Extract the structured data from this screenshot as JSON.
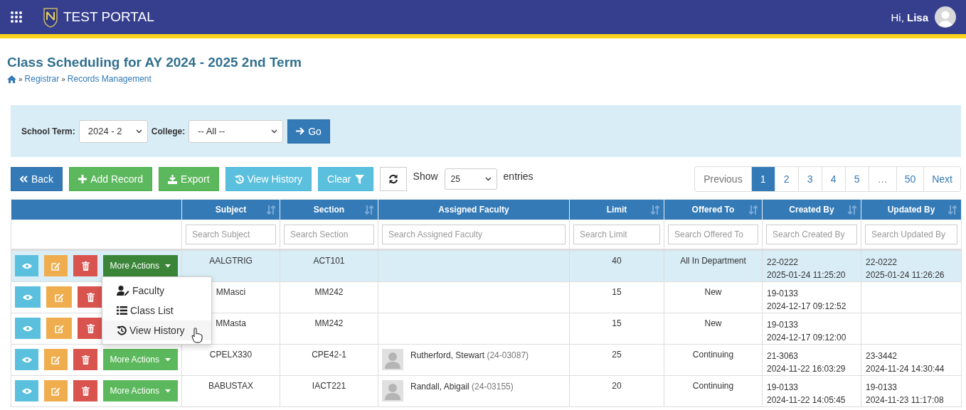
{
  "header": {
    "brand": "TEST PORTAL",
    "greeting": "Hi, ",
    "user": "Lisa"
  },
  "page": {
    "title": "Class Scheduling for AY 2024 - 2025 2nd Term",
    "breadcrumb": [
      "Registrar",
      "Records Management"
    ],
    "separator": "»"
  },
  "filter": {
    "term_label": "School Term:",
    "term_value": "2024 - 2",
    "college_label": "College:",
    "college_value": "-- All --",
    "go_button": "Go"
  },
  "toolbar": {
    "back": "Back",
    "add": "Add Record",
    "export": "Export",
    "history": "View History",
    "clear": "Clear",
    "show_label": "Show",
    "page_size": "25",
    "entries_label": "entries"
  },
  "pagination": [
    {
      "label": "Previous",
      "selected": false,
      "kind": "text"
    },
    {
      "label": "1",
      "selected": true,
      "kind": "link"
    },
    {
      "label": "2",
      "selected": false,
      "kind": "link"
    },
    {
      "label": "3",
      "selected": false,
      "kind": "link"
    },
    {
      "label": "4",
      "selected": false,
      "kind": "link"
    },
    {
      "label": "5",
      "selected": false,
      "kind": "link"
    },
    {
      "label": "…",
      "selected": false,
      "kind": "text"
    },
    {
      "label": "50",
      "selected": false,
      "kind": "link"
    },
    {
      "label": "Next",
      "selected": false,
      "kind": "link"
    }
  ],
  "table": {
    "columns": [
      {
        "label": "Subject",
        "placeholder": "Search Subject"
      },
      {
        "label": "Section",
        "placeholder": "Search Section"
      },
      {
        "label": "Assigned Faculty",
        "placeholder": "Search Assigned Faculty"
      },
      {
        "label": "Limit",
        "placeholder": "Search Limit"
      },
      {
        "label": "Offered To",
        "placeholder": "Search Offered To"
      },
      {
        "label": "Created By",
        "placeholder": "Search Created By"
      },
      {
        "label": "Updated By",
        "placeholder": "Search Updated By"
      }
    ],
    "rows": [
      {
        "selected": true,
        "more_actions": "More Actions",
        "subject": "AALGTRIG",
        "section": "ACT101",
        "limit": "40",
        "offered_to": "All In Department",
        "created_by": "22-0222",
        "created_at": "2025-01-24 11:25:20",
        "updated_by": "22-0222",
        "updated_at": "2025-01-24 11:26:26"
      },
      {
        "selected": false,
        "subject": "MMasci",
        "section": "MM242",
        "limit": "15",
        "offered_to": "New",
        "created_by": "19-0133",
        "created_at": "2024-12-17 09:12:52"
      },
      {
        "selected": false,
        "subject": "MMasta",
        "section": "MM242",
        "limit": "15",
        "offered_to": "New",
        "created_by": "19-0133",
        "created_at": "2024-12-17 09:12:00"
      },
      {
        "selected": false,
        "more_actions": "More Actions",
        "subject": "CPELX330",
        "section": "CPE42-1",
        "faculty_name": "Rutherford, Stewart",
        "faculty_id": "(24-03087)",
        "limit": "25",
        "offered_to": "Continuing",
        "created_by": "21-3063",
        "created_at": "2024-11-22 16:03:29",
        "updated_by": "23-3442",
        "updated_at": "2024-11-24 14:30:44"
      },
      {
        "selected": false,
        "more_actions": "More Actions",
        "subject": "BABUSTAX",
        "section": "IACT221",
        "faculty_name": "Randall, Abigail",
        "faculty_id": "(24-03155)",
        "limit": "20",
        "offered_to": "Continuing",
        "created_by": "19-0133",
        "created_at": "2024-11-22 14:05:45",
        "updated_by": "19-0133",
        "updated_at": "2024-11-23 11:17:08"
      }
    ]
  },
  "dropdown_menu": [
    {
      "label": "Faculty",
      "kind": "faculty",
      "selected": false
    },
    {
      "label": "Class List",
      "kind": "list",
      "selected": false
    },
    {
      "label": "View History",
      "kind": "history",
      "selected": true
    }
  ]
}
